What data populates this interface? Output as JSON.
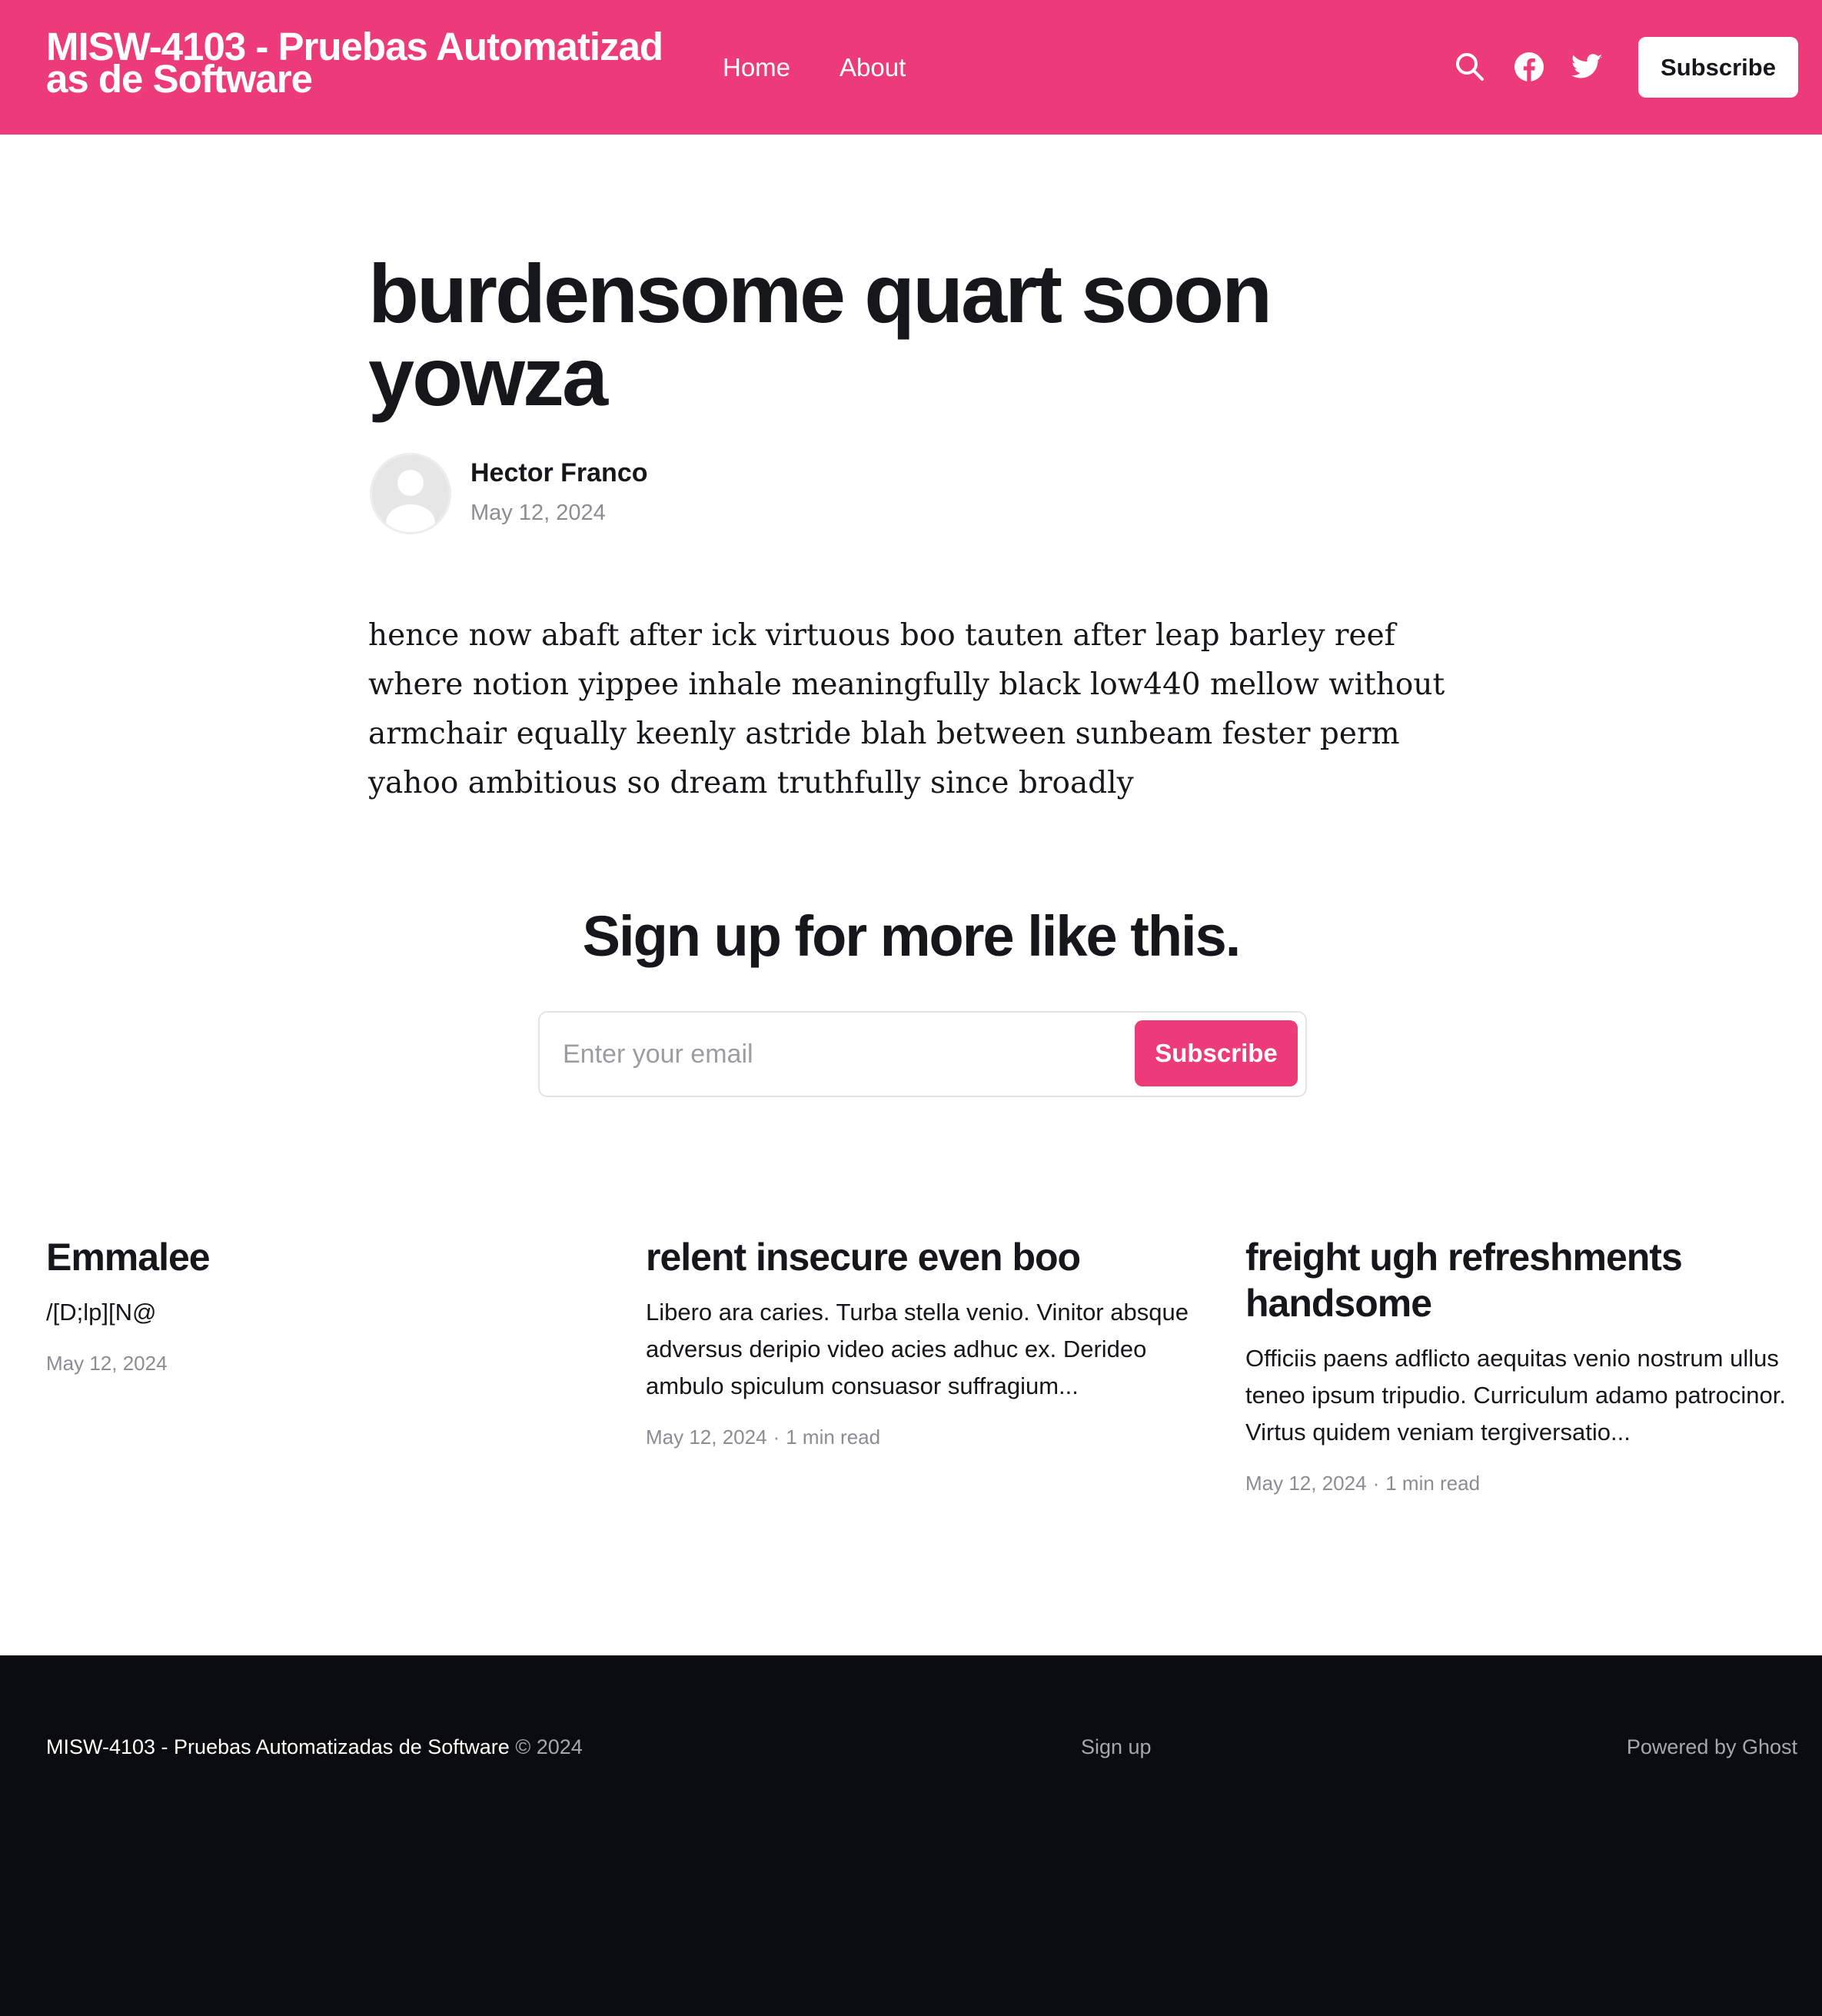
{
  "header": {
    "site_title": "MISW-4103 - Pruebas Automatizadas de Software",
    "nav": [
      "Home",
      "About"
    ],
    "icons": [
      "search-icon",
      "facebook-icon",
      "twitter-icon"
    ],
    "subscribe_label": "Subscribe",
    "background_color": "#ec3b78"
  },
  "post": {
    "title": "burdensome quart soon yowza",
    "author": "Hector Franco",
    "date": "May 12, 2024",
    "body": "hence now abaft after ick virtuous boo tauten after leap barley reef where notion yippee inhale meaningfully black low440 mellow without armchair equally keenly astride blah between sunbeam fester perm yahoo ambitious so dream truthfully since broadly"
  },
  "signup": {
    "title": "Sign up for more like this.",
    "email_placeholder": "Enter your email",
    "button_label": "Subscribe"
  },
  "related": [
    {
      "title": "Emmalee",
      "excerpt": "/[D;lp][N@",
      "date": "May 12, 2024",
      "read_time": ""
    },
    {
      "title": "relent insecure even boo",
      "excerpt": "Libero ara caries. Turba stella venio. Vinitor absque adversus deripio video acies adhuc ex. Derideo ambulo spiculum consuasor suffragium...",
      "date": "May 12, 2024",
      "read_time": "1 min read"
    },
    {
      "title": "freight ugh refreshments handsome",
      "excerpt": "Officiis paens adflicto aequitas venio nostrum ullus teneo ipsum tripudio. Curriculum adamo patrocinor. Virtus quidem veniam tergiversatio...",
      "date": "May 12, 2024",
      "read_time": "1 min read"
    }
  ],
  "footer": {
    "site_name": "MISW-4103 - Pruebas Automatizadas de Software",
    "copyright": "© 2024",
    "signup_link": "Sign up",
    "powered_by": "Powered by Ghost"
  }
}
